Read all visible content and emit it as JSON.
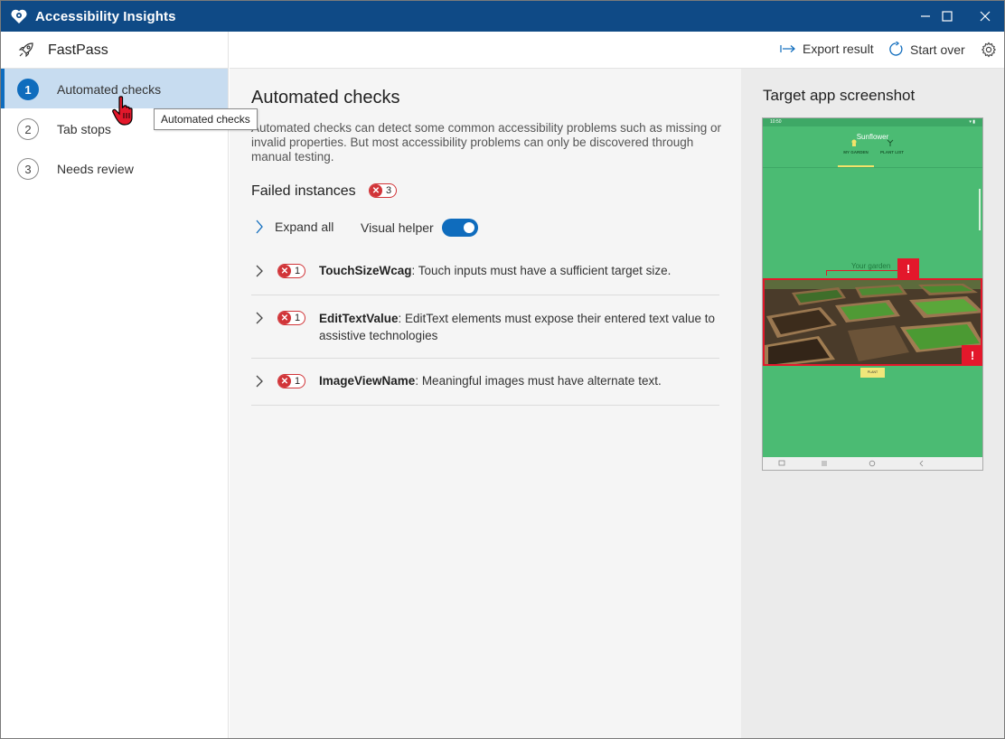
{
  "window": {
    "title": "Accessibility Insights",
    "titlebar_color": "#0f4a86"
  },
  "sidebar": {
    "header": "FastPass",
    "items": [
      {
        "number": "1",
        "label": "Automated checks",
        "selected": true
      },
      {
        "number": "2",
        "label": "Tab stops",
        "selected": false
      },
      {
        "number": "3",
        "label": "Needs review",
        "selected": false
      }
    ]
  },
  "toolbar": {
    "export_label": "Export result",
    "start_over_label": "Start over"
  },
  "main": {
    "title": "Automated checks",
    "description": "Automated checks can detect some common accessibility problems such as missing or invalid properties. But most accessibility problems can only be discovered through manual testing.",
    "failed_title": "Failed instances",
    "failed_count": "3",
    "expand_all": "Expand all",
    "visual_helper": "Visual helper",
    "visual_helper_on": true,
    "rules": [
      {
        "count": "1",
        "name": "TouchSizeWcag",
        "desc": ": Touch inputs must have a sufficient target size."
      },
      {
        "count": "1",
        "name": "EditTextValue",
        "desc": ": EditText elements must expose their entered text value to assistive technologies"
      },
      {
        "count": "1",
        "name": "ImageViewName",
        "desc": ": Meaningful images must have alternate text."
      }
    ]
  },
  "right_panel": {
    "title": "Target app screenshot",
    "phone": {
      "status_time": "10:50",
      "app_title": "Sunflower",
      "tab_my_garden": "MY GARDEN",
      "tab_plant_list": "PLANT LIST",
      "garden_label": "Your garden",
      "plant_button": "PLANT",
      "warning_glyph": "!"
    }
  },
  "tooltip": {
    "text": "Automated checks"
  },
  "colors": {
    "accent": "#0f6cbd",
    "error": "#d13438",
    "app_green": "#4bbb73"
  }
}
